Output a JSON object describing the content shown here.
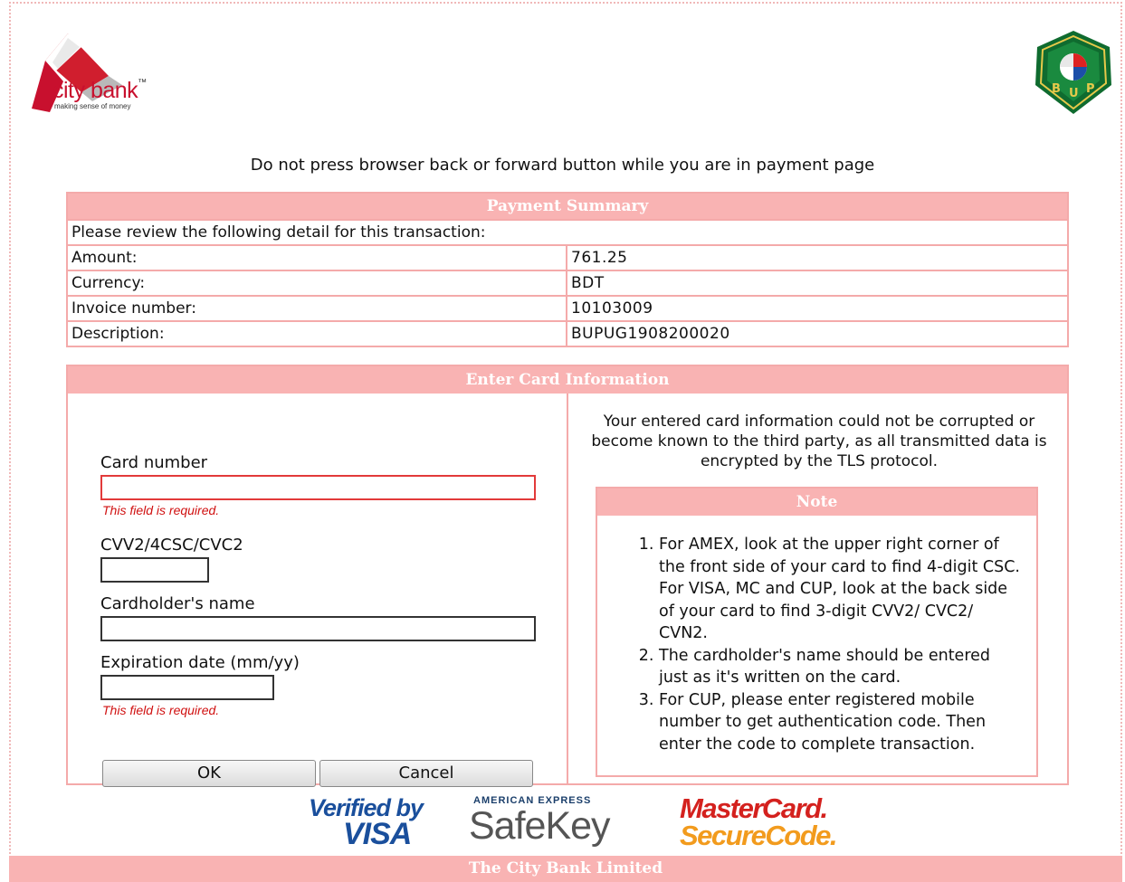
{
  "brand": {
    "bank_name": "city bank",
    "bank_tagline": "making sense of money",
    "partner_logo_letters": "BUP",
    "accent_color": "#f9b3b3"
  },
  "warning_text": "Do not press browser back or forward button while you are in payment page",
  "summary": {
    "title": "Payment Summary",
    "intro": "Please review the following detail for this transaction:",
    "rows": [
      {
        "label": "Amount:",
        "value": "761.25"
      },
      {
        "label": "Currency:",
        "value": "BDT"
      },
      {
        "label": "Invoice number:",
        "value": "10103009"
      },
      {
        "label": "Description:",
        "value": "BUPUG1908200020"
      }
    ]
  },
  "card_form": {
    "title": "Enter Card Information",
    "card_number_label": "Card number",
    "card_number_value": "",
    "card_number_error": "This field is required.",
    "cvv_label": "CVV2/4CSC/CVC2",
    "cvv_value": "",
    "cardholder_label": "Cardholder's name",
    "cardholder_value": "",
    "expiry_label": "Expiration date (mm/yy)",
    "expiry_value": "",
    "expiry_error": "This field is required.",
    "ok_label": "OK",
    "cancel_label": "Cancel"
  },
  "security": {
    "text": "Your entered card information could not be corrupted or become known to the third party, as all transmitted data is encrypted by the TLS protocol.",
    "note_title": "Note",
    "notes": [
      "For AMEX, look at the upper right corner of the front side of your card to find 4-digit CSC. For VISA, MC and CUP, look at the back side of your card to find 3-digit CVV2/ CVC2/ CVN2.",
      "The cardholder's name should be entered just as it's written on the card.",
      "For CUP, please enter registered mobile number to get authentication code. Then enter the code to complete transaction."
    ]
  },
  "badges": {
    "visa_line1": "Verified by",
    "visa_line2": "VISA",
    "amex_line1": "AMERICAN EXPRESS",
    "amex_line2": "SafeKey",
    "mc_line1": "MasterCard.",
    "mc_line2": "SecureCode."
  },
  "footer_text": "The City Bank Limited"
}
